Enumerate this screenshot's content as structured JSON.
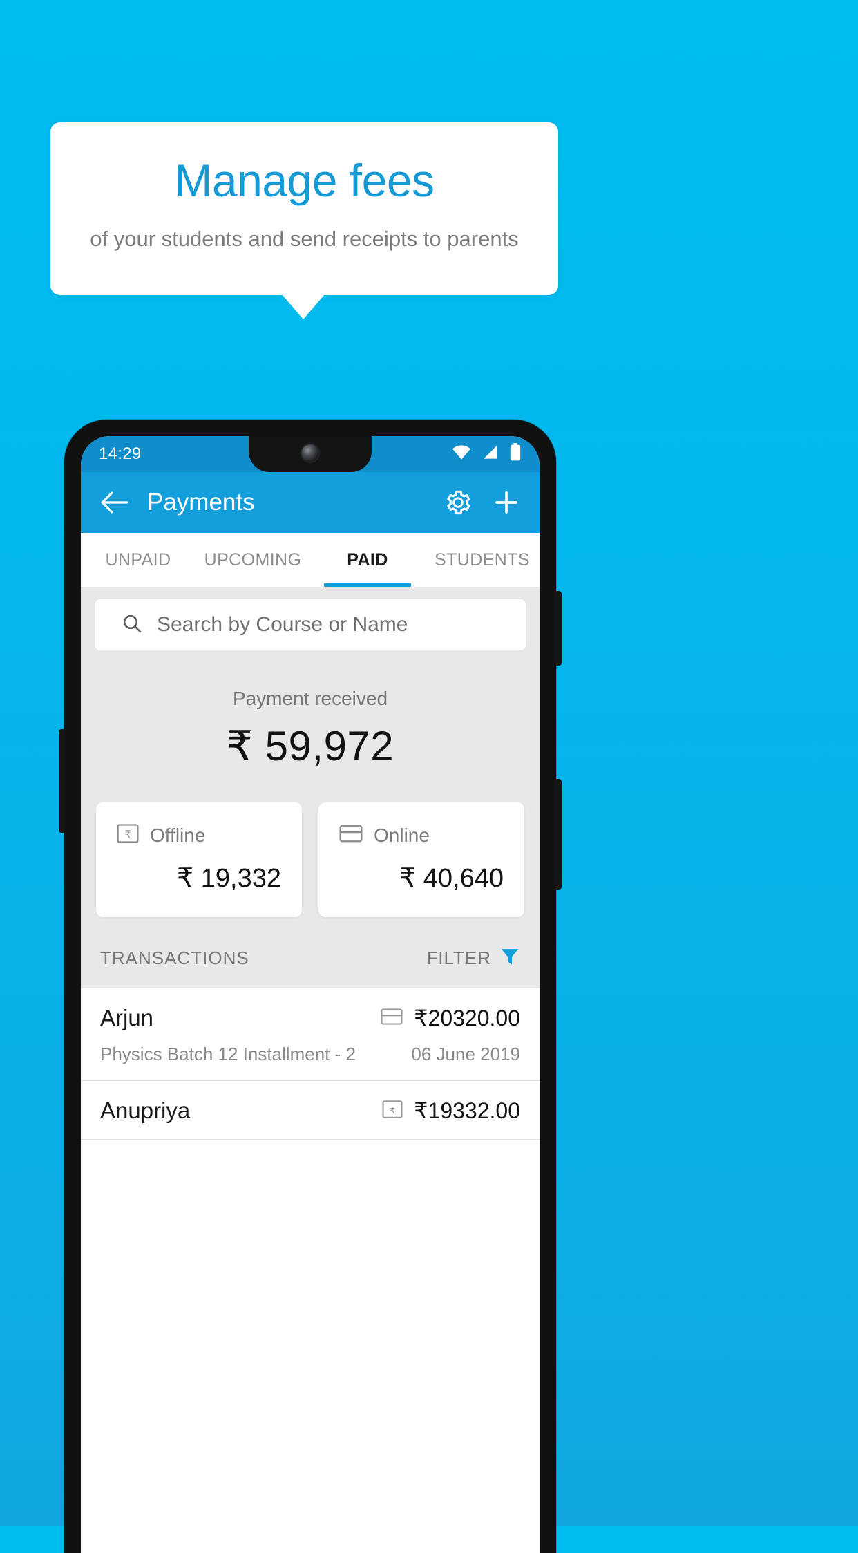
{
  "callout": {
    "title": "Manage fees",
    "subtitle": "of your students and send receipts to parents"
  },
  "colors": {
    "background_top": "#00bdf0",
    "background_bottom": "#11a6e0",
    "accent": "#139fdc",
    "title_blue": "#159ad6",
    "statusbar": "#0f8ecb",
    "content_bg": "#e8e8e8"
  },
  "phone": {
    "statusbar": {
      "time": "14:29",
      "icons": [
        "wifi-icon",
        "signal-icon",
        "battery-icon"
      ]
    },
    "appbar": {
      "back_icon": "back-arrow-icon",
      "title": "Payments",
      "settings_icon": "gear-icon",
      "add_icon": "plus-icon"
    },
    "tabs": [
      {
        "label": "UNPAID",
        "active": false
      },
      {
        "label": "UPCOMING",
        "active": false
      },
      {
        "label": "PAID",
        "active": true
      },
      {
        "label": "STUDENTS",
        "active": false
      }
    ],
    "search": {
      "icon": "search-icon",
      "placeholder": "Search by Course or Name",
      "value": ""
    },
    "summary": {
      "label": "Payment received",
      "amount": "₹ 59,972"
    },
    "methods": [
      {
        "icon": "rupee-note-icon",
        "label": "Offline",
        "amount": "₹ 19,332"
      },
      {
        "icon": "credit-card-icon",
        "label": "Online",
        "amount": "₹ 40,640"
      }
    ],
    "transactions_header": {
      "title": "TRANSACTIONS",
      "filter_label": "FILTER",
      "filter_icon": "funnel-icon"
    },
    "transactions": [
      {
        "name": "Arjun",
        "amount": "₹20320.00",
        "method_icon": "credit-card-icon",
        "description": "Physics Batch 12 Installment - 2",
        "date": "06 June 2019"
      },
      {
        "name": "Anupriya",
        "amount": "₹19332.00",
        "method_icon": "rupee-note-icon",
        "description": "",
        "date": ""
      }
    ]
  }
}
